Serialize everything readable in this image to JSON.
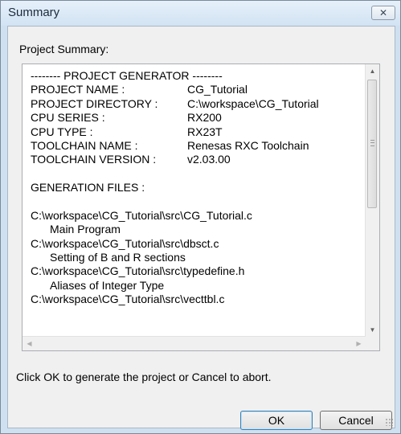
{
  "window": {
    "title": "Summary"
  },
  "section_label": "Project Summary:",
  "summary": {
    "header": "-------- PROJECT GENERATOR --------",
    "fields": [
      {
        "key": "PROJECT NAME :",
        "value": "CG_Tutorial"
      },
      {
        "key": "PROJECT DIRECTORY :",
        "value": "C:\\workspace\\CG_Tutorial"
      },
      {
        "key": "CPU SERIES :",
        "value": "RX200"
      },
      {
        "key": "CPU TYPE :",
        "value": "RX23T"
      },
      {
        "key": "TOOLCHAIN NAME :",
        "value": "Renesas RXC Toolchain"
      },
      {
        "key": "TOOLCHAIN VERSION :",
        "value": "v2.03.00"
      }
    ],
    "generation_files_label": "GENERATION FILES :",
    "files": [
      {
        "path": "C:\\workspace\\CG_Tutorial\\src\\CG_Tutorial.c",
        "desc": "Main Program"
      },
      {
        "path": "C:\\workspace\\CG_Tutorial\\src\\dbsct.c",
        "desc": "Setting of B and R sections"
      },
      {
        "path": "C:\\workspace\\CG_Tutorial\\src\\typedefine.h",
        "desc": "Aliases of Integer Type"
      },
      {
        "path": "C:\\workspace\\CG_Tutorial\\src\\vecttbl.c",
        "desc": ""
      }
    ]
  },
  "hint_text": "Click OK to generate the project or Cancel to abort.",
  "buttons": {
    "ok": "OK",
    "cancel": "Cancel"
  },
  "icons": {
    "close": "close-icon",
    "scroll_up": "arrow-up-icon",
    "scroll_down": "arrow-down-icon",
    "scroll_left": "arrow-left-icon",
    "scroll_right": "arrow-right-icon"
  }
}
